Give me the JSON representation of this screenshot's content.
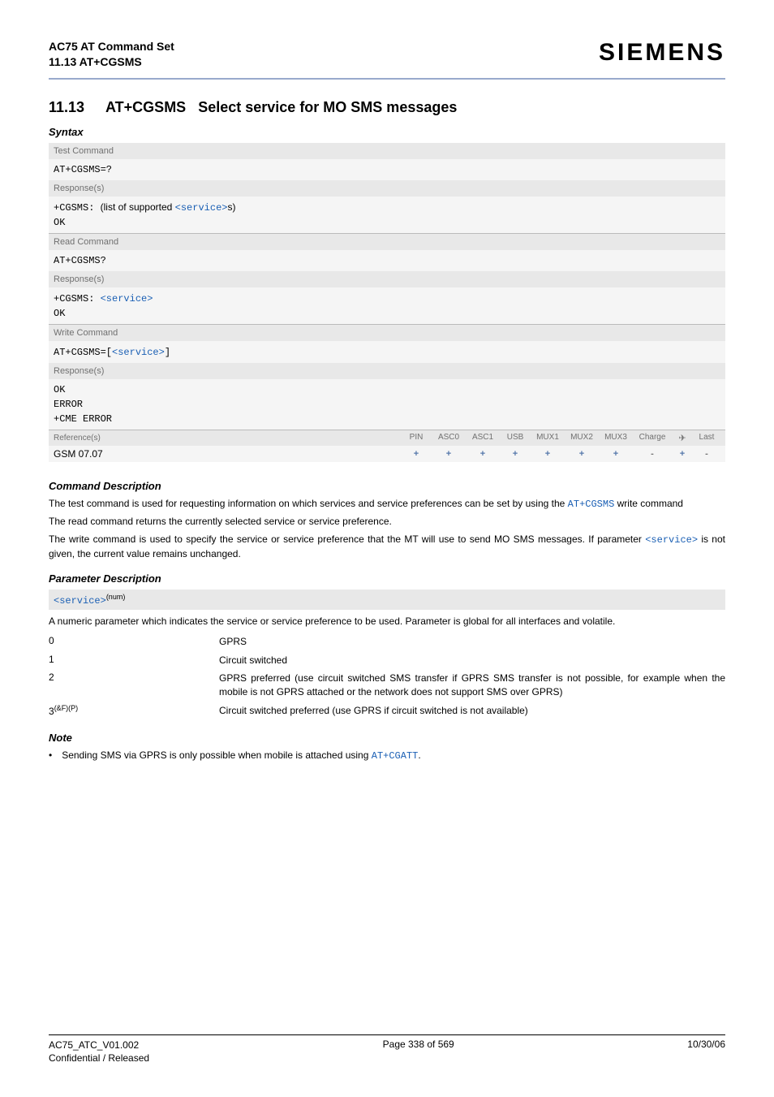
{
  "header": {
    "doc_title": "AC75 AT Command Set",
    "section_ref": "11.13 AT+CGSMS",
    "brand": "SIEMENS"
  },
  "title": {
    "number": "11.13",
    "command": "AT+CGSMS",
    "rest": "Select service for MO SMS messages"
  },
  "syntax": {
    "label": "Syntax",
    "test": {
      "header": "Test Command",
      "cmd": "AT+CGSMS=?",
      "resp_label": "Response(s)",
      "resp_prefix": "+CGSMS: ",
      "resp_text_open": "(list of supported ",
      "resp_param": "<service>",
      "resp_text_close": "s)",
      "ok": "OK"
    },
    "read": {
      "header": "Read Command",
      "cmd": "AT+CGSMS?",
      "resp_label": "Response(s)",
      "resp_prefix": "+CGSMS: ",
      "resp_param": "<service>",
      "ok": "OK"
    },
    "write": {
      "header": "Write Command",
      "cmd_prefix": "AT+CGSMS=[",
      "cmd_param": "<service>",
      "cmd_suffix": "]",
      "resp_label": "Response(s)",
      "ok": "OK",
      "err": "ERROR",
      "cme": "+CME ERROR"
    },
    "refs": {
      "label": "Reference(s)",
      "cols": [
        "PIN",
        "ASC0",
        "ASC1",
        "USB",
        "MUX1",
        "MUX2",
        "MUX3",
        "Charge",
        "",
        "Last"
      ],
      "value_label": "GSM 07.07",
      "values": [
        "+",
        "+",
        "+",
        "+",
        "+",
        "+",
        "+",
        "-",
        "+",
        "-"
      ]
    }
  },
  "cmd_desc": {
    "label": "Command Description",
    "p1a": "The test command is used for requesting information on which services and service preferences can be set by using the ",
    "p1_link": "AT+CGSMS",
    "p1b": " write command",
    "p2": "The read command returns the currently selected service or service preference.",
    "p3a": "The write command is used to specify the service or service preference that the MT will use to send MO SMS messages. If parameter ",
    "p3_link": "<service>",
    "p3b": " is not given, the current value remains unchanged."
  },
  "param_desc": {
    "label": "Parameter Description",
    "name": "<service>",
    "suffix": "(num)",
    "intro": "A numeric parameter which indicates the service or service preference to be used. Parameter is global for all interfaces and volatile.",
    "rows": [
      {
        "key": "0",
        "sup": "",
        "desc": "GPRS"
      },
      {
        "key": "1",
        "sup": "",
        "desc": "Circuit switched"
      },
      {
        "key": "2",
        "sup": "",
        "desc": "GPRS preferred (use circuit switched SMS transfer if GPRS SMS transfer is not possible, for example when the mobile is not GPRS attached or the network does not support SMS over GPRS)"
      },
      {
        "key": "3",
        "sup": "(&F)(P)",
        "desc": "Circuit switched preferred (use GPRS if circuit switched is not available)"
      }
    ]
  },
  "note": {
    "label": "Note",
    "bullet": "•",
    "text_a": "Sending SMS via GPRS is only possible when mobile is attached using ",
    "link": "AT+CGATT",
    "text_b": "."
  },
  "footer": {
    "left1": "AC75_ATC_V01.002",
    "left2": "Confidential / Released",
    "center": "Page 338 of 569",
    "right": "10/30/06"
  }
}
